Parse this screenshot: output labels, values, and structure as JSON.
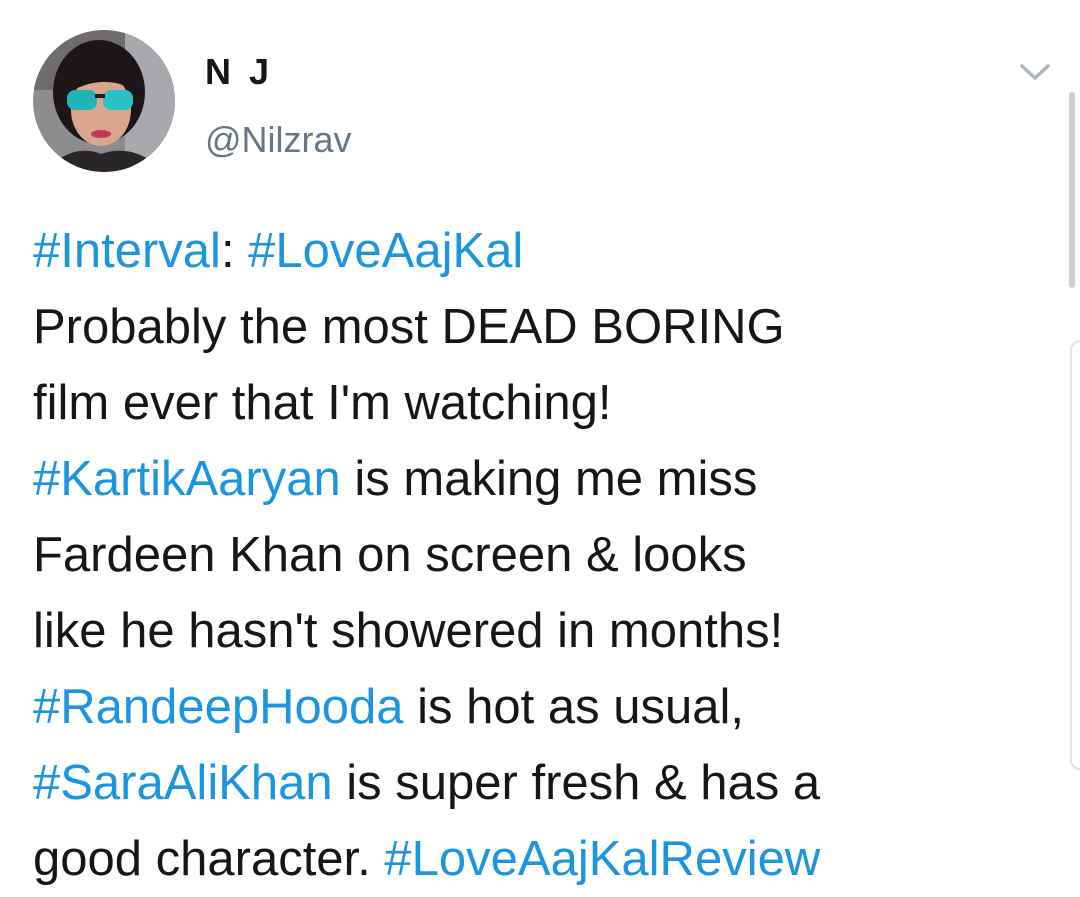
{
  "tweet": {
    "author": {
      "display_name": "N J",
      "handle": "@Nilzrav",
      "avatar": "profile-photo-avatar"
    },
    "menu_icon": "chevron-down-icon",
    "lines": [
      [
        {
          "text": "#Interval",
          "hashtag": true
        },
        {
          "text": ": ",
          "hashtag": false
        },
        {
          "text": "#LoveAajKal",
          "hashtag": true
        }
      ],
      [
        {
          "text": "Probably the most DEAD BORING",
          "hashtag": false
        }
      ],
      [
        {
          "text": "film ever that I'm watching!",
          "hashtag": false
        }
      ],
      [
        {
          "text": "#KartikAaryan",
          "hashtag": true
        },
        {
          "text": " is making me miss",
          "hashtag": false
        }
      ],
      [
        {
          "text": "Fardeen Khan on screen & looks",
          "hashtag": false
        }
      ],
      [
        {
          "text": "like he hasn't showered in months!",
          "hashtag": false
        }
      ],
      [
        {
          "text": "#RandeepHooda",
          "hashtag": true
        },
        {
          "text": " is hot as usual,",
          "hashtag": false
        }
      ],
      [
        {
          "text": "#SaraAliKhan",
          "hashtag": true
        },
        {
          "text": " is super fresh & has a",
          "hashtag": false
        }
      ],
      [
        {
          "text": "good character. ",
          "hashtag": false
        },
        {
          "text": "#LoveAajKalReview",
          "hashtag": true
        }
      ]
    ]
  },
  "colors": {
    "hashtag": "#1b95e0",
    "text": "#14171a",
    "handle": "#657786",
    "icon": "#aab8c2"
  }
}
